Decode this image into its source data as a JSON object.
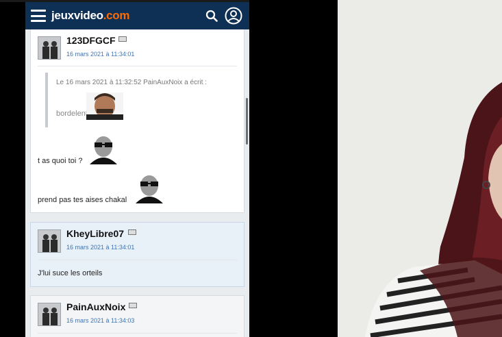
{
  "site": {
    "logo_main": "jeuxvideo",
    "logo_suffix": ".com",
    "icons": [
      "menu-icon",
      "search-icon",
      "account-icon"
    ]
  },
  "posts": [
    {
      "author": "123DFGCF",
      "date": "16 mars 2021 à 11:34:01",
      "quote_header": "Le 16 mars 2021 à 11:32:52 PainAuxNoix a écrit :",
      "quote_text": "bordelent",
      "lines": [
        "t as quoi toi ?",
        "prend pas tes aises chakal"
      ]
    },
    {
      "author": "KheyLibre07",
      "date": "16 mars 2021 à 11:34:01",
      "text": "J'lui suce les orteils"
    },
    {
      "author": "PainAuxNoix",
      "date": "16 mars 2021 à 11:34:03"
    }
  ],
  "colors": {
    "header": "#0f3055",
    "logo_accent": "#ff6a00",
    "date_link": "#3a73b5",
    "highlight_post": "#e8f0f8"
  }
}
